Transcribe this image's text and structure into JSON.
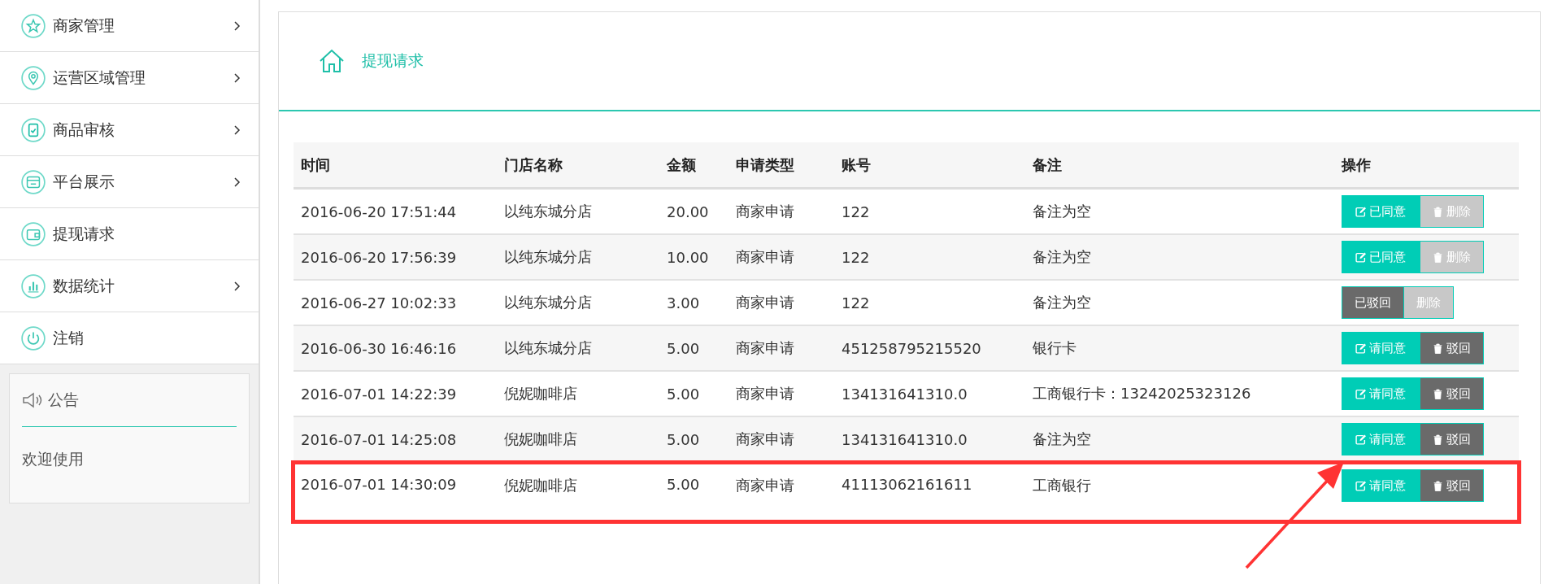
{
  "sidebar": {
    "items": [
      {
        "label": "商家管理",
        "has_submenu": true
      },
      {
        "label": "运营区域管理",
        "has_submenu": true
      },
      {
        "label": "商品审核",
        "has_submenu": true
      },
      {
        "label": "平台展示",
        "has_submenu": true
      },
      {
        "label": "提现请求",
        "has_submenu": false
      },
      {
        "label": "数据统计",
        "has_submenu": true
      },
      {
        "label": "注销",
        "has_submenu": false
      }
    ],
    "notice": {
      "title": "公告",
      "body": "欢迎使用"
    }
  },
  "page": {
    "title": "提现请求"
  },
  "table": {
    "columns": [
      "时间",
      "门店名称",
      "金额",
      "申请类型",
      "账号",
      "备注",
      "操作"
    ],
    "rows": [
      {
        "cells": [
          "2016-06-20 17:51:44",
          "以纯东城分店",
          "20.00",
          "商家申请",
          "122",
          "备注为空"
        ],
        "highlighted": false,
        "actions": [
          {
            "label": "已同意",
            "kind": "teal",
            "has_icon": true
          },
          {
            "label": "删除",
            "kind": "grey",
            "has_icon": true
          }
        ]
      },
      {
        "cells": [
          "2016-06-20 17:56:39",
          "以纯东城分店",
          "10.00",
          "商家申请",
          "122",
          "备注为空"
        ],
        "highlighted": false,
        "actions": [
          {
            "label": "已同意",
            "kind": "teal",
            "has_icon": true
          },
          {
            "label": "删除",
            "kind": "grey",
            "has_icon": true
          }
        ]
      },
      {
        "cells": [
          "2016-06-27 10:02:33",
          "以纯东城分店",
          "3.00",
          "商家申请",
          "122",
          "备注为空"
        ],
        "highlighted": false,
        "actions": [
          {
            "label": "已驳回",
            "kind": "dark",
            "has_icon": false
          },
          {
            "label": "删除",
            "kind": "grey",
            "has_icon": false
          }
        ]
      },
      {
        "cells": [
          "2016-06-30 16:46:16",
          "以纯东城分店",
          "5.00",
          "商家申请",
          "451258795215520",
          "银行卡"
        ],
        "highlighted": false,
        "actions": [
          {
            "label": "请同意",
            "kind": "teal",
            "has_icon": true
          },
          {
            "label": "驳回",
            "kind": "dark",
            "has_icon": true
          }
        ]
      },
      {
        "cells": [
          "2016-07-01 14:22:39",
          "倪妮咖啡店",
          "5.00",
          "商家申请",
          "134131641310.0",
          "工商银行卡：13242025323126"
        ],
        "highlighted": false,
        "actions": [
          {
            "label": "请同意",
            "kind": "teal",
            "has_icon": true
          },
          {
            "label": "驳回",
            "kind": "dark",
            "has_icon": true
          }
        ]
      },
      {
        "cells": [
          "2016-07-01 14:25:08",
          "倪妮咖啡店",
          "5.00",
          "商家申请",
          "134131641310.0",
          "备注为空"
        ],
        "highlighted": false,
        "actions": [
          {
            "label": "请同意",
            "kind": "teal",
            "has_icon": true
          },
          {
            "label": "驳回",
            "kind": "dark",
            "has_icon": true
          }
        ]
      },
      {
        "cells": [
          "2016-07-01 14:30:09",
          "倪妮咖啡店",
          "5.00",
          "商家申请",
          "41113062161611",
          "工商银行"
        ],
        "highlighted": true,
        "actions": [
          {
            "label": "请同意",
            "kind": "teal",
            "has_icon": true
          },
          {
            "label": "驳回",
            "kind": "dark",
            "has_icon": true
          }
        ]
      }
    ]
  }
}
